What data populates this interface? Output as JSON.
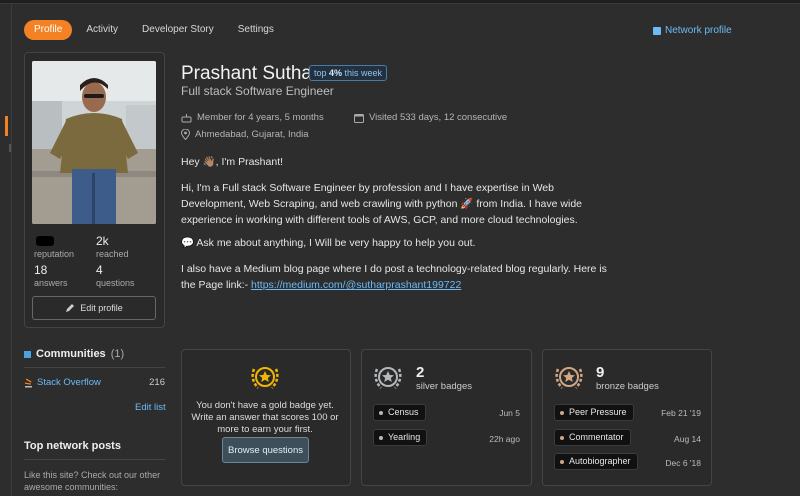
{
  "tabs": [
    {
      "label": "Profile",
      "active": true
    },
    {
      "label": "Activity",
      "active": false
    },
    {
      "label": "Developer Story",
      "active": false
    },
    {
      "label": "Settings",
      "active": false
    }
  ],
  "network_profile": "Network profile",
  "profile": {
    "name": "Prashant Suthar",
    "top_badge": {
      "prefix": "top ",
      "pct": "4%",
      "suffix": " this week"
    },
    "role": "Full stack Software Engineer",
    "member_for": "Member for 4 years, 5 months",
    "visited": "Visited 533 days, 12 consecutive",
    "location": "Ahmedabad, Gujarat, India",
    "greeting": "Hey 👋🏽, I'm Prashant!",
    "about": "Hi, I'm a Full stack Software Engineer by profession and I have expertise in Web Development, Web Scraping, and web crawling with python 🚀 from India. I have wide experience in working with different tools of AWS, GCP, and more cloud technologies.",
    "ask": "💬 Ask me about anything, I Will be very happy to help you out.",
    "medium_text": "I also have a Medium blog page where I do post a technology-related blog regularly. Here is the Page link:- ",
    "medium_link": "https://medium.com/@sutharprashant199722"
  },
  "stats": {
    "reputation_label": "reputation",
    "reached_value": "2k",
    "reached_label": "reached",
    "answers_value": "18",
    "answers_label": "answers",
    "questions_value": "4",
    "questions_label": "questions"
  },
  "edit_profile": "Edit profile",
  "communities": {
    "title": "Communities",
    "count": "(1)",
    "items": [
      {
        "name": "Stack Overflow",
        "rep": "216"
      }
    ],
    "edit_list": "Edit list"
  },
  "top_network_posts": "Top network posts",
  "like_site": "Like this site? Check out our other awesome communities:",
  "badges": {
    "gold": {
      "empty_text": "You don't have a gold badge yet. Write an answer that scores 100 or more to earn your first.",
      "browse": "Browse questions",
      "color": "#f1b600"
    },
    "silver": {
      "count": "2",
      "label": "silver badges",
      "color": "#b4b8bc",
      "items": [
        {
          "name": "Census",
          "date": "Jun 5"
        },
        {
          "name": "Yearling",
          "date": "22h ago"
        }
      ]
    },
    "bronze": {
      "count": "9",
      "label": "bronze badges",
      "color": "#d1a684",
      "items": [
        {
          "name": "Peer Pressure",
          "date": "Feb 21 '19"
        },
        {
          "name": "Commentator",
          "date": "Aug 14"
        },
        {
          "name": "Autobiographer",
          "date": "Dec 6 '18"
        }
      ]
    }
  }
}
